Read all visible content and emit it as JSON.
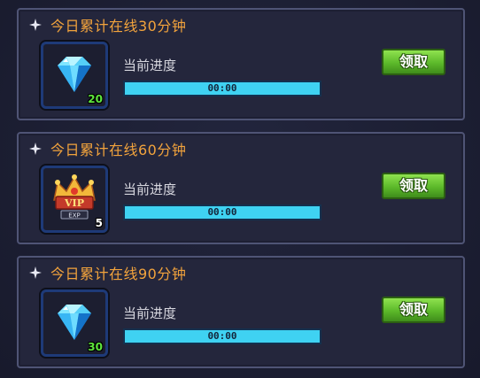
{
  "rewards": [
    {
      "title": "今日累计在线30分钟",
      "item_icon": "diamond-icon",
      "item_count": "20",
      "count_color": "#5ee63c",
      "progress_label": "当前进度",
      "progress_text": "00:00",
      "progress": 1.0,
      "button_label": "领取"
    },
    {
      "title": "今日累计在线60分钟",
      "item_icon": "vip-exp-crown-icon",
      "item_count": "5",
      "count_color": "#ffffff",
      "icon_badge": "VIP",
      "icon_sub_badge": "EXP",
      "progress_label": "当前进度",
      "progress_text": "00:00",
      "progress": 1.0,
      "button_label": "领取"
    },
    {
      "title": "今日累计在线90分钟",
      "item_icon": "diamond-icon",
      "item_count": "30",
      "count_color": "#5ee63c",
      "progress_label": "当前进度",
      "progress_text": "00:00",
      "progress": 1.0,
      "button_label": "领取"
    }
  ],
  "colors": {
    "title": "#f2a33c",
    "button": "#5cb92a",
    "bar": "#3fd2f2"
  }
}
